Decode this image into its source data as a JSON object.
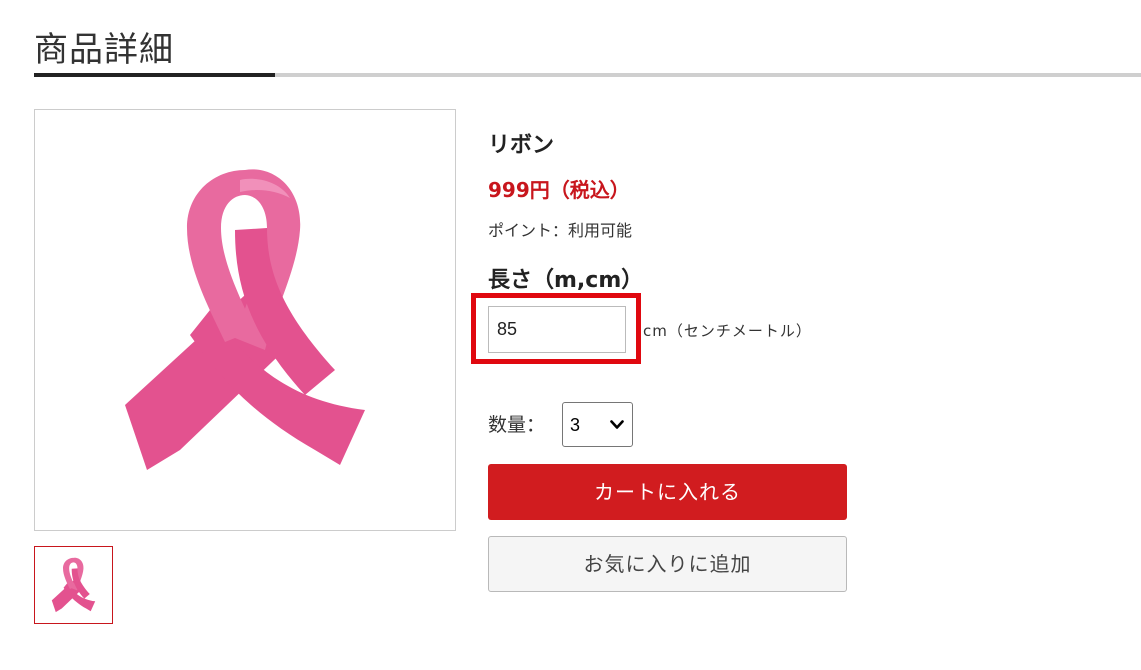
{
  "page": {
    "title": "商品詳細"
  },
  "product": {
    "name": "リボン",
    "price": "999円",
    "tax_note": "（税込）",
    "points": "ポイント：利用可能",
    "image_icon": "pink-ribbon-icon"
  },
  "option": {
    "heading": "長さ（m,cm）",
    "length_value": "85",
    "unit_label": "cm（センチメートル）"
  },
  "quantity": {
    "label": "数量：",
    "selected": "3",
    "dropdown_icon": "chevron-down-icon"
  },
  "actions": {
    "cart_label": "カートに入れる",
    "favorite_label": "お気に入りに追加"
  },
  "colors": {
    "accent_red": "#d11c1f",
    "price_red": "#c8161d",
    "highlight_red": "#e0080f",
    "ribbon_pink": "#e3528f"
  }
}
